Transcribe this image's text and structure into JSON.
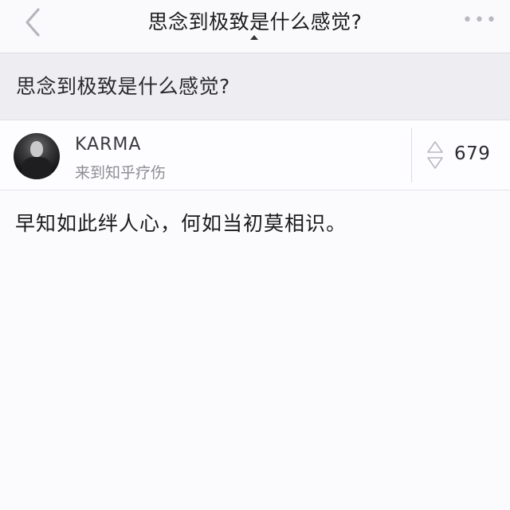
{
  "navbar": {
    "title": "思念到极致是什么感觉?",
    "back_icon": "chevron-left-icon",
    "more_icon": "more-horizontal-icon",
    "more_glyph": "•••"
  },
  "question": {
    "title": "思念到极致是什么感觉?"
  },
  "author": {
    "name": "KARMA",
    "bio": "来到知乎疗伤",
    "votes": "679"
  },
  "answer": {
    "text": "早知如此绊人心，何如当初莫相识。"
  },
  "colors": {
    "nav_bg": "#fafafc",
    "question_band_bg": "#ededf2",
    "text_primary": "#1a1a1c",
    "text_secondary": "#8e8e93",
    "icon_gray": "#b9b9bf"
  }
}
